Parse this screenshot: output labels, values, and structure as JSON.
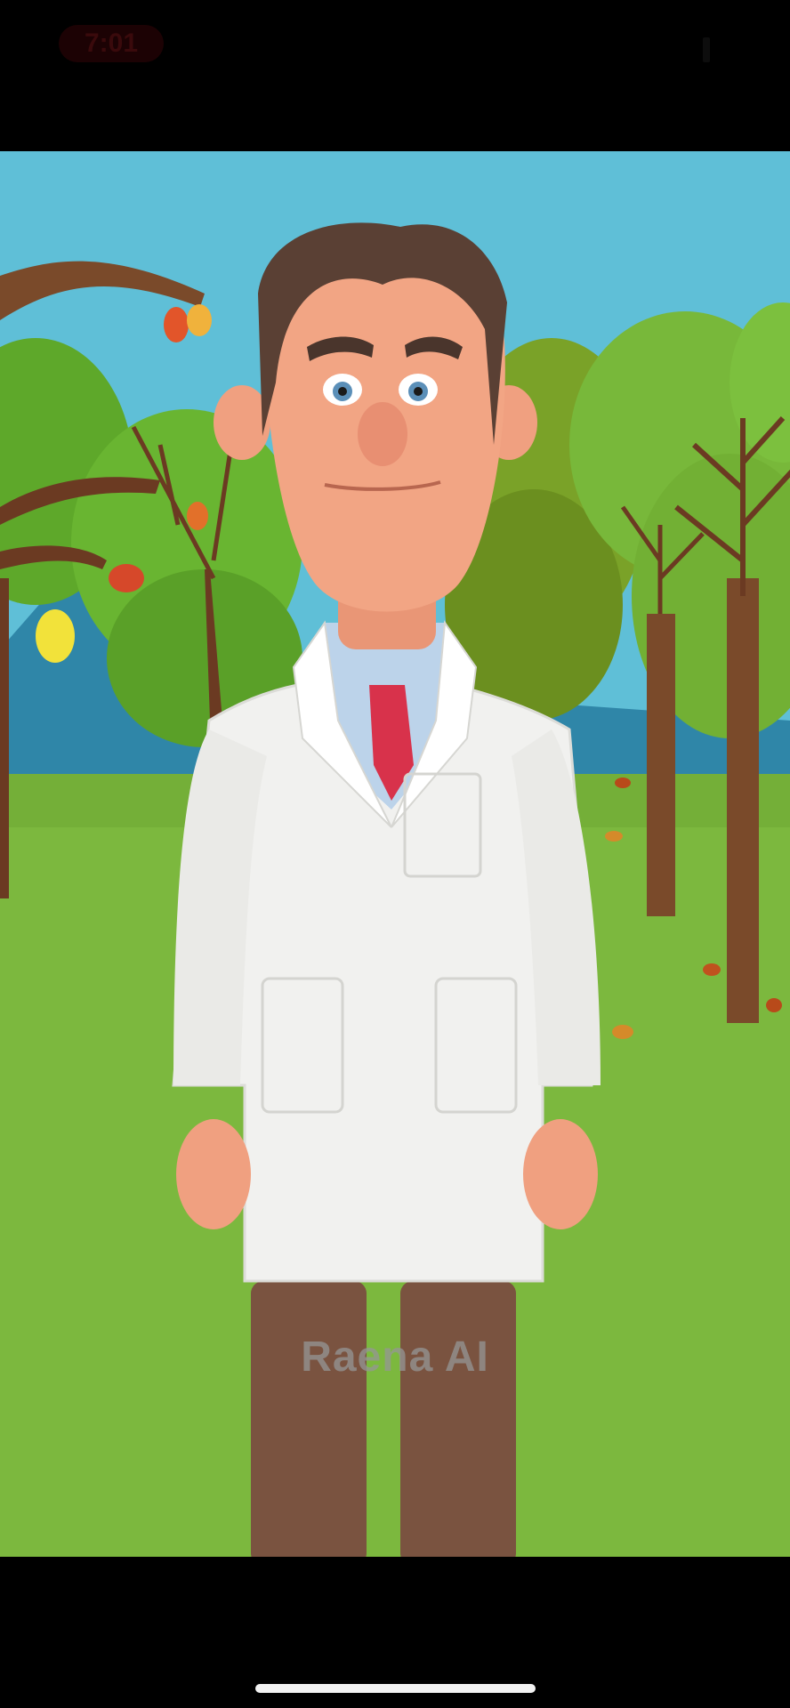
{
  "status_bar": {
    "time": "7:01"
  },
  "video": {
    "watermark": "Raena AI"
  }
}
